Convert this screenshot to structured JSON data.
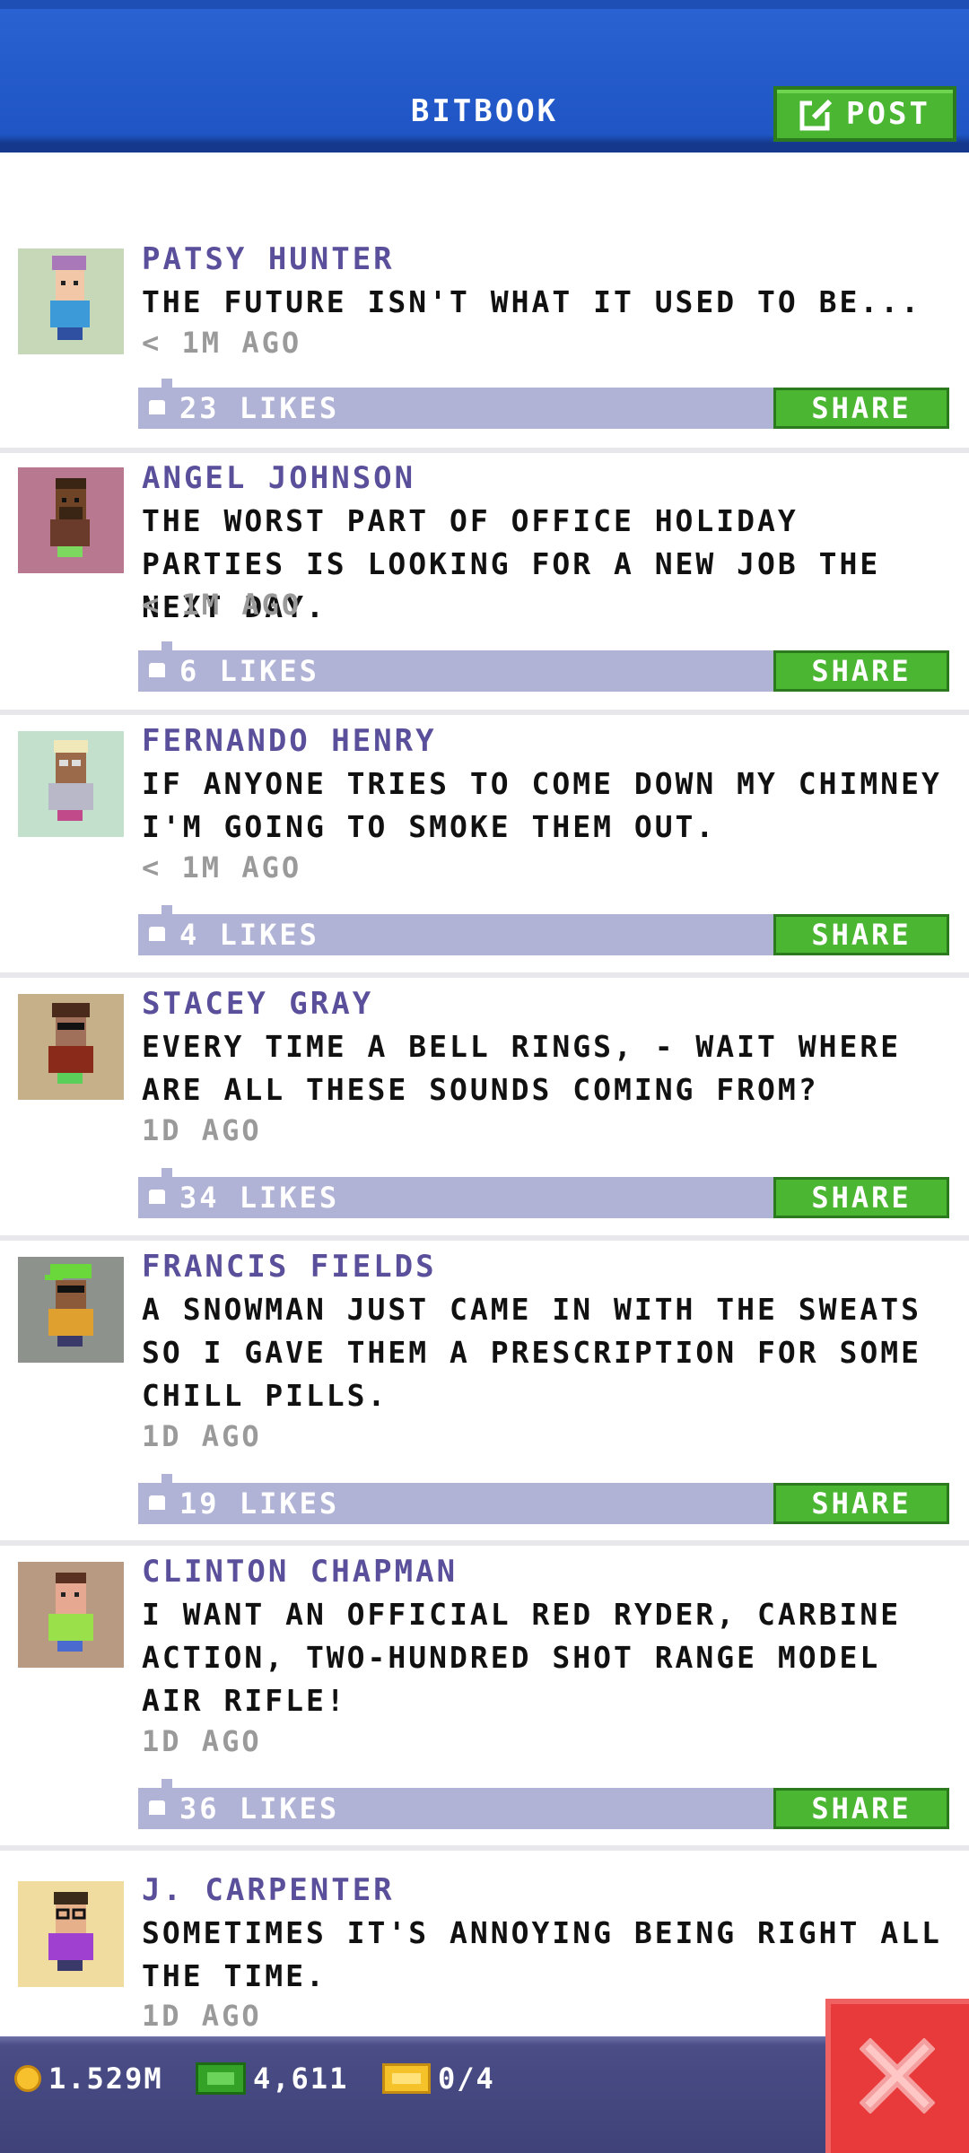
{
  "header": {
    "title": "BITBOOK",
    "post_label": "POST"
  },
  "posts": [
    {
      "name": "PATSY HUNTER",
      "text": "THE FUTURE ISN'T WHAT IT USED TO BE...",
      "time": "< 1M AGO",
      "likes": "23 LIKES",
      "share": "SHARE"
    },
    {
      "name": "ANGEL JOHNSON",
      "text": "THE WORST PART OF OFFICE HOLIDAY PARTIES IS LOOKING FOR A NEW JOB THE NEXT DAY.",
      "time": "< 1M AGO",
      "likes": "6 LIKES",
      "share": "SHARE"
    },
    {
      "name": "FERNANDO HENRY",
      "text": "IF ANYONE TRIES TO COME DOWN MY CHIMNEY I'M GOING TO SMOKE THEM OUT.",
      "time": "< 1M AGO",
      "likes": "4 LIKES",
      "share": "SHARE"
    },
    {
      "name": "STACEY GRAY",
      "text": "EVERY TIME A BELL RINGS, - WAIT WHERE ARE ALL THESE SOUNDS COMING FROM?",
      "time": "1D AGO",
      "likes": "34 LIKES",
      "share": "SHARE"
    },
    {
      "name": "FRANCIS FIELDS",
      "text": "A SNOWMAN JUST CAME IN WITH THE SWEATS SO I GAVE THEM A PRESCRIPTION FOR SOME CHILL PILLS.",
      "time": "1D AGO",
      "likes": "19 LIKES",
      "share": "SHARE"
    },
    {
      "name": "CLINTON CHAPMAN",
      "text": "I WANT AN OFFICIAL RED RYDER, CARBINE ACTION, TWO-HUNDRED SHOT RANGE MODEL AIR RIFLE!",
      "time": "1D AGO",
      "likes": "36 LIKES",
      "share": "SHARE"
    },
    {
      "name": "J. CARPENTER",
      "text": "SOMETIMES IT'S ANNOYING BEING RIGHT ALL THE TIME.",
      "time": "1D AGO"
    }
  ],
  "footer": {
    "coins": "1.529M",
    "bux": "4,611",
    "tickets": "0/4"
  },
  "colors": {
    "header_blue": "#1f55c4",
    "accent_green": "#4ab631",
    "like_bar": "#b0b2d6",
    "close_red": "#e83a3a"
  }
}
